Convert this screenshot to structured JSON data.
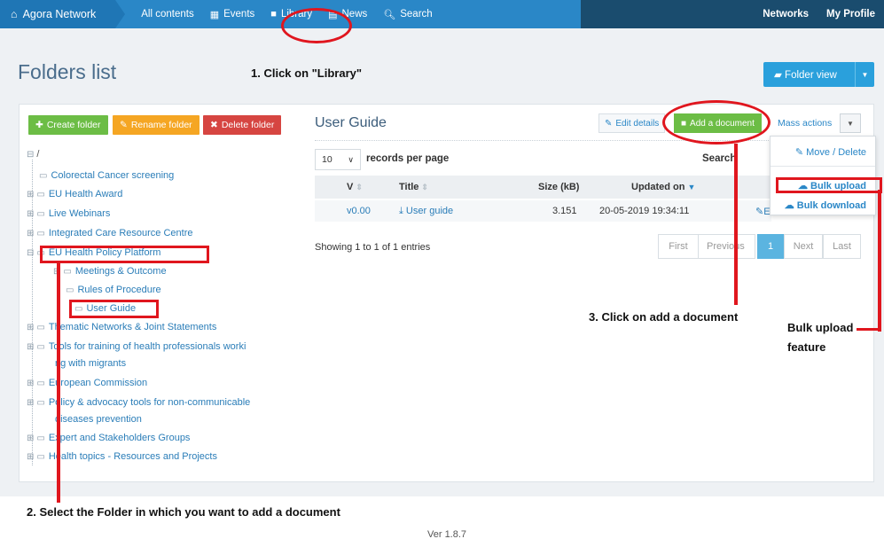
{
  "navbar": {
    "brand": "Agora Network",
    "items": [
      {
        "label": "All contents",
        "icon": ""
      },
      {
        "label": "Events",
        "icon": "calendar-icon"
      },
      {
        "label": "Library",
        "icon": "document-icon"
      },
      {
        "label": "News",
        "icon": "newspaper-icon"
      },
      {
        "label": "Search",
        "icon": "search-icon"
      }
    ],
    "right": [
      "Networks",
      "My Profile"
    ]
  },
  "header": {
    "title": "Folders list",
    "folder_view": "Folder view"
  },
  "folder_actions": {
    "create": "Create folder",
    "rename": "Rename folder",
    "delete": "Delete folder"
  },
  "tree": {
    "root": "/",
    "items": [
      "Colorectal Cancer screening",
      "EU Health Award",
      "Live Webinars",
      "Integrated Care Resource Centre",
      "EU Health Policy Platform",
      "Meetings & Outcome",
      "Rules of Procedure",
      "User Guide",
      "Thematic Networks & Joint Statements",
      "Tools for training of health professionals worki",
      "ng with migrants",
      "European Commission",
      "Policy & advocacy tools for non-communicable",
      "diseases prevention",
      "Expert and Stakeholders Groups",
      "Health topics - Resources and Projects"
    ]
  },
  "content": {
    "title": "User Guide",
    "edit_details": "Edit details",
    "add_document": "Add a document",
    "mass_actions": "Mass actions",
    "records_value": "10",
    "records_per_page": "records per page",
    "search_label": "Search",
    "columns": [
      "V",
      "Title",
      "Size (kB)",
      "Updated on"
    ],
    "rows": [
      {
        "version": "v0.00",
        "title": "User guide",
        "size": "3.151",
        "updated": "20-05-2019 19:34:11",
        "action": "E"
      }
    ],
    "showing": "Showing 1 to 1 of 1 entries",
    "pager": [
      "First",
      "Previous",
      "1",
      "Next",
      "Last"
    ]
  },
  "dropdown": {
    "move_delete": "Move / Delete",
    "bulk_upload": "Bulk upload",
    "bulk_download": "Bulk download"
  },
  "annotations": {
    "step1": "1. Click on \"Library\"",
    "step2": "2. Select the Folder in which you want to add a document",
    "step3": "3. Click on add a document",
    "bulk_line1": "Bulk upload",
    "bulk_line2": "feature",
    "color": "#e0161e"
  },
  "footer": {
    "version": "Ver 1.8.7"
  }
}
